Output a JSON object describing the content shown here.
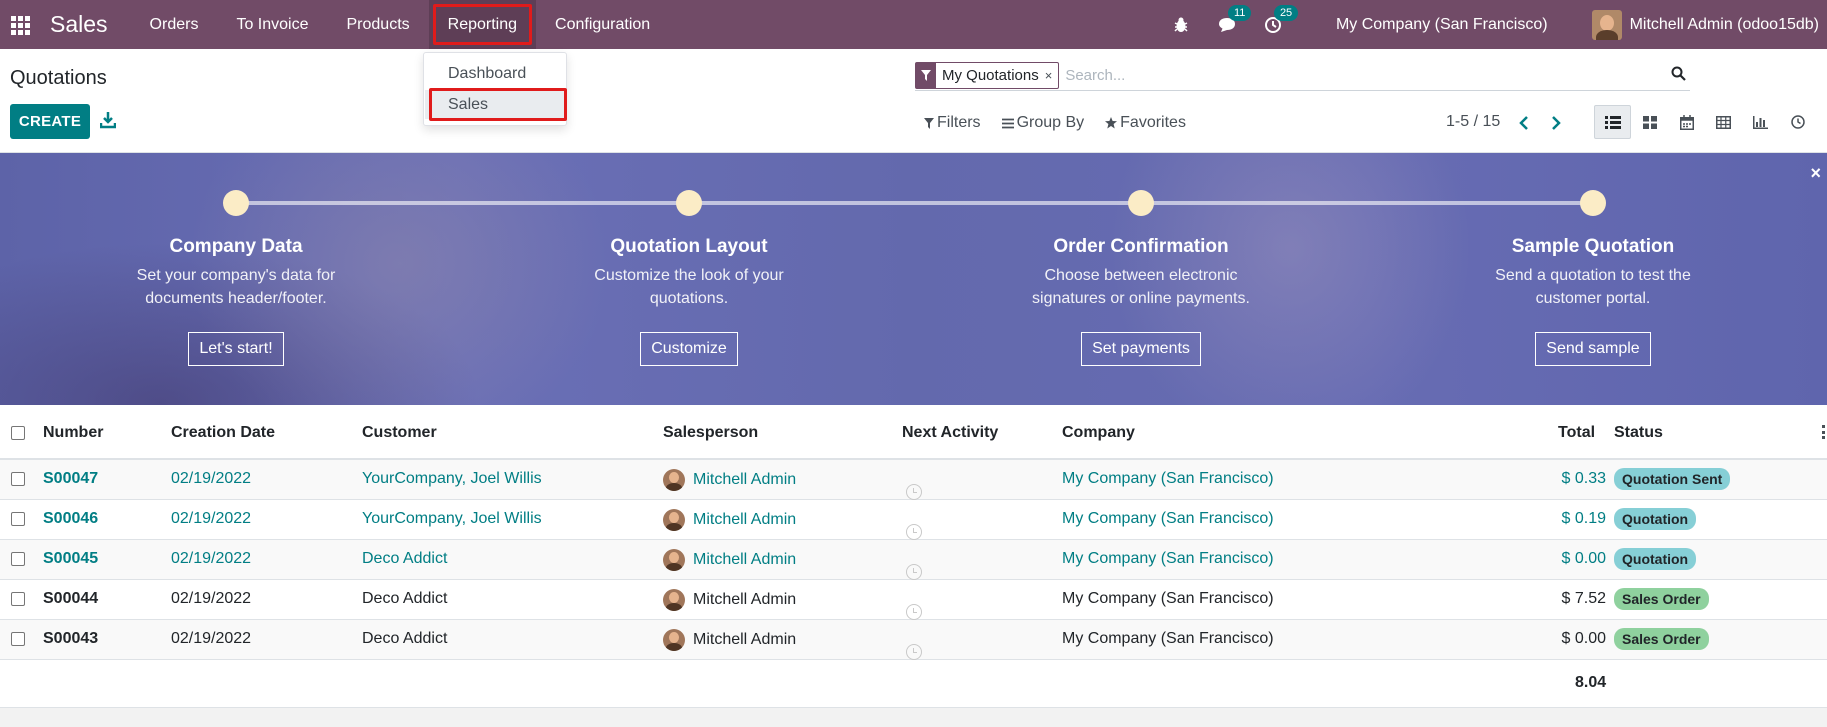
{
  "navbar": {
    "app_name": "Sales",
    "menu": [
      "Orders",
      "To Invoice",
      "Products",
      "Reporting",
      "Configuration"
    ],
    "messages_count": "11",
    "activities_count": "25",
    "company": "My Company (San Francisco)",
    "user": "Mitchell Admin (odoo15db)"
  },
  "dropdown": {
    "items": [
      "Dashboard",
      "Sales"
    ]
  },
  "control_panel": {
    "title": "Quotations",
    "create_label": "CREATE",
    "facet_label": "My Quotations",
    "facet_remove": "×",
    "search_placeholder": "Search...",
    "filters_label": "Filters",
    "group_by_label": "Group By",
    "favorites_label": "Favorites",
    "pager": "1-5 / 15"
  },
  "banner": {
    "steps": [
      {
        "title": "Company Data",
        "desc": "Set your company's data for documents header/footer.",
        "button": "Let's start!"
      },
      {
        "title": "Quotation Layout",
        "desc": "Customize the look of your quotations.",
        "button": "Customize"
      },
      {
        "title": "Order Confirmation",
        "desc": "Choose between electronic signatures or online payments.",
        "button": "Set payments"
      },
      {
        "title": "Sample Quotation",
        "desc": "Send a quotation to test the customer portal.",
        "button": "Send sample"
      }
    ],
    "close": "×"
  },
  "table": {
    "columns": {
      "number": "Number",
      "date": "Creation Date",
      "customer": "Customer",
      "salesperson": "Salesperson",
      "activity": "Next Activity",
      "company": "Company",
      "total": "Total",
      "status": "Status"
    },
    "rows": [
      {
        "number": "S00047",
        "date": "02/19/2022",
        "customer": "YourCompany, Joel Willis",
        "salesperson": "Mitchell Admin",
        "company": "My Company (San Francisco)",
        "total": "$ 0.33",
        "status": "Quotation Sent"
      },
      {
        "number": "S00046",
        "date": "02/19/2022",
        "customer": "YourCompany, Joel Willis",
        "salesperson": "Mitchell Admin",
        "company": "My Company (San Francisco)",
        "total": "$ 0.19",
        "status": "Quotation"
      },
      {
        "number": "S00045",
        "date": "02/19/2022",
        "customer": "Deco Addict",
        "salesperson": "Mitchell Admin",
        "company": "My Company (San Francisco)",
        "total": "$ 0.00",
        "status": "Quotation"
      },
      {
        "number": "S00044",
        "date": "02/19/2022",
        "customer": "Deco Addict",
        "salesperson": "Mitchell Admin",
        "company": "My Company (San Francisco)",
        "total": "$ 7.52",
        "status": "Sales Order"
      },
      {
        "number": "S00043",
        "date": "02/19/2022",
        "customer": "Deco Addict",
        "salesperson": "Mitchell Admin",
        "company": "My Company (San Francisco)",
        "total": "$ 0.00",
        "status": "Sales Order"
      }
    ],
    "sum_total": "8.04"
  },
  "colors": {
    "brand": "#714b67",
    "accent": "#017e84",
    "highlight": "#e01b1b",
    "badge_quotation": "#86cfd6",
    "badge_sales_order": "#8fd19e"
  },
  "icons": [
    "apps-icon",
    "bug-icon",
    "chat-icon",
    "activity-icon",
    "download-icon",
    "filter-icon",
    "search-icon",
    "chevron-left-icon",
    "chevron-right-icon",
    "list-view-icon",
    "kanban-view-icon",
    "calendar-view-icon",
    "pivot-view-icon",
    "graph-view-icon",
    "activity-view-icon",
    "clock-icon",
    "close-icon"
  ]
}
